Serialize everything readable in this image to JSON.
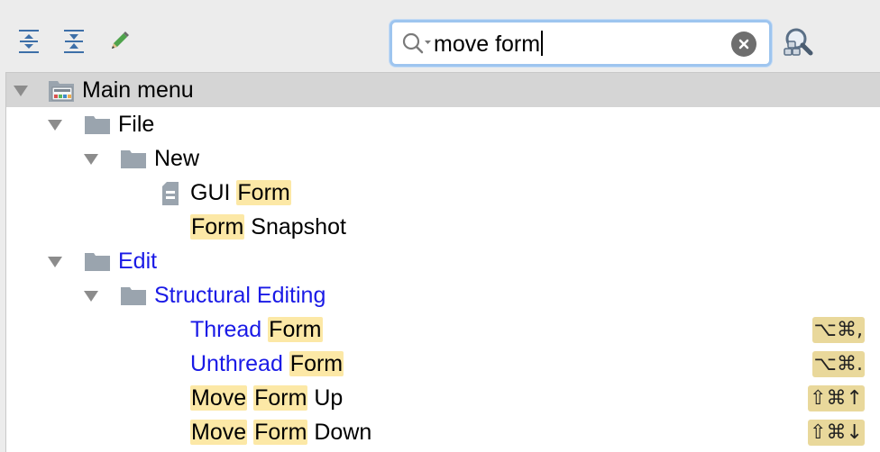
{
  "toolbar": {
    "expand_all_icon": "expand-all-icon",
    "collapse_all_icon": "collapse-all-icon",
    "edit_icon": "pencil-icon",
    "find_shortcut_icon": "find-by-shortcut-icon"
  },
  "search": {
    "value": "move form",
    "icon": "search-icon",
    "clear_icon": "clear-icon"
  },
  "tree": {
    "rows": [
      {
        "label": "Main menu",
        "link": false
      },
      {
        "label": "File",
        "link": false
      },
      {
        "label": "New",
        "link": false
      },
      {
        "prefix": "GUI ",
        "highlight1": "Form"
      },
      {
        "highlight1": "Form",
        "suffix": " Snapshot"
      },
      {
        "label": "Edit",
        "link": true
      },
      {
        "label": "Structural Editing",
        "link": true
      },
      {
        "prefix": "Thread ",
        "highlight1": "Form",
        "shortcut": "⌥⌘,"
      },
      {
        "prefix": "Unthread ",
        "highlight1": "Form",
        "shortcut": "⌥⌘."
      },
      {
        "highlight1": "Move",
        "highlight2": "Form",
        "suffix": " Up",
        "shortcut": "⇧⌘↑"
      },
      {
        "highlight1": "Move",
        "highlight2": "Form",
        "suffix": " Down",
        "shortcut": "⇧⌘↓"
      }
    ]
  },
  "colors": {
    "highlight": "#fce8a6",
    "shortcut_bg": "#e9d89b",
    "link": "#1a1ae6",
    "selected_row": "#d5d5d5",
    "search_focus": "#9ec5ef"
  }
}
